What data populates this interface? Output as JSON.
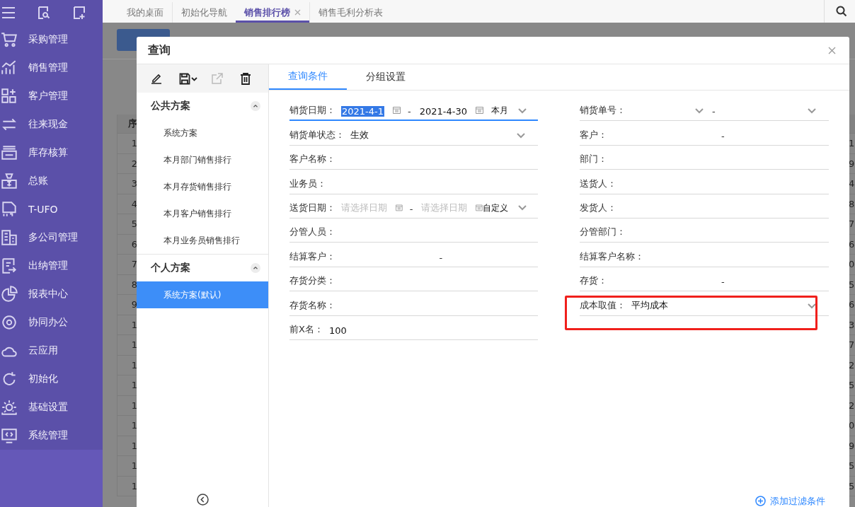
{
  "sidebar": {
    "items": [
      {
        "label": "采购管理"
      },
      {
        "label": "销售管理"
      },
      {
        "label": "客户管理"
      },
      {
        "label": "往来现金"
      },
      {
        "label": "库存核算"
      },
      {
        "label": "总账"
      },
      {
        "label": "T-UFO"
      },
      {
        "label": "多公司管理"
      },
      {
        "label": "出纳管理"
      },
      {
        "label": "报表中心"
      },
      {
        "label": "协同办公"
      },
      {
        "label": "云应用"
      },
      {
        "label": "初始化"
      },
      {
        "label": "基础设置"
      },
      {
        "label": "系统管理"
      }
    ]
  },
  "tabs": [
    {
      "label": "我的桌面",
      "selected": false,
      "closable": false
    },
    {
      "label": "初始化导航",
      "selected": false,
      "closable": false
    },
    {
      "label": "销售排行榜",
      "selected": true,
      "closable": true
    },
    {
      "label": "销售毛利分析表",
      "selected": false,
      "closable": false
    }
  ],
  "background_table": {
    "header": "序",
    "first_column": [
      "1",
      "2",
      "3",
      "4",
      "5",
      "6",
      "7",
      "8",
      "9",
      "1",
      "1",
      "1",
      "1",
      "1",
      "1",
      "1",
      "1",
      "1"
    ],
    "last_column": [
      "1",
      "9",
      "4",
      "8",
      "7",
      "6",
      "0",
      "5",
      "6",
      "3",
      "7",
      "2",
      "5",
      "2",
      "0",
      "9",
      "5",
      "5"
    ]
  },
  "dialog": {
    "title": "查询",
    "scheme_groups": [
      {
        "title": "公共方案",
        "expanded": true,
        "items": [
          {
            "label": "系统方案",
            "selected": false
          },
          {
            "label": "本月部门销售排行",
            "selected": false
          },
          {
            "label": "本月存货销售排行",
            "selected": false
          },
          {
            "label": "本月客户销售排行",
            "selected": false
          },
          {
            "label": "本月业务员销售排行",
            "selected": false
          }
        ]
      },
      {
        "title": "个人方案",
        "expanded": true,
        "items": [
          {
            "label": "系统方案(默认)",
            "selected": true
          }
        ]
      }
    ],
    "tabs": [
      {
        "label": "查询条件",
        "selected": true
      },
      {
        "label": "分组设置",
        "selected": false
      }
    ],
    "left_fields": [
      {
        "kind": "date_range",
        "label": "销货日期：",
        "from": "2021-4-1",
        "from_selected": true,
        "separator": "-",
        "to": "2021-4-30",
        "period": "本月",
        "focused": true,
        "highlighted": false
      },
      {
        "kind": "select",
        "label": "销货单状态：",
        "value": "生效",
        "focused": false,
        "highlighted": false
      },
      {
        "kind": "text",
        "label": "客户名称：",
        "focused": false,
        "highlighted": false
      },
      {
        "kind": "text",
        "label": "业务员：",
        "focused": false,
        "highlighted": false
      },
      {
        "kind": "date_range",
        "label": "送货日期：",
        "from_placeholder": "请选择日期",
        "separator": "-",
        "to_placeholder": "请选择日期",
        "period": "自定义",
        "focused": false,
        "highlighted": false
      },
      {
        "kind": "text",
        "label": "分管人员：",
        "focused": false,
        "highlighted": false
      },
      {
        "kind": "range",
        "label": "结算客户：",
        "separator": "-",
        "focused": false,
        "highlighted": false
      },
      {
        "kind": "text",
        "label": "存货分类：",
        "focused": false,
        "highlighted": false
      },
      {
        "kind": "text",
        "label": "存货名称：",
        "focused": false,
        "highlighted": false
      },
      {
        "kind": "text",
        "label": "前X名：",
        "value": "100",
        "focused": false,
        "highlighted": false
      }
    ],
    "right_fields": [
      {
        "kind": "select_range",
        "label": "销货单号：",
        "separator": "-",
        "focused": false,
        "highlighted": false
      },
      {
        "kind": "range",
        "label": "客户：",
        "separator": "-",
        "focused": false,
        "highlighted": false
      },
      {
        "kind": "text",
        "label": "部门：",
        "focused": false,
        "highlighted": false
      },
      {
        "kind": "text",
        "label": "送货人：",
        "focused": false,
        "highlighted": false
      },
      {
        "kind": "text",
        "label": "发货人：",
        "focused": false,
        "highlighted": false
      },
      {
        "kind": "text",
        "label": "分管部门：",
        "focused": false,
        "highlighted": false
      },
      {
        "kind": "text",
        "label": "结算客户名称：",
        "focused": false,
        "highlighted": false
      },
      {
        "kind": "range",
        "label": "存货：",
        "separator": "-",
        "focused": false,
        "highlighted": false
      },
      {
        "kind": "select",
        "label": "成本取值：",
        "value": "平均成本",
        "focused": false,
        "highlighted": true
      }
    ],
    "add_filter": "添加过滤条件"
  }
}
